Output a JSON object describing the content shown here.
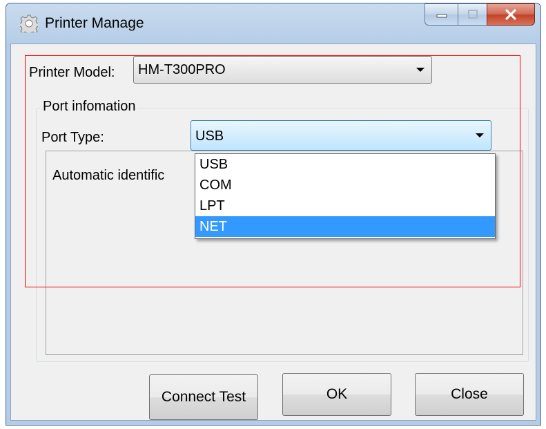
{
  "window": {
    "title": "Printer Manage",
    "icons": {
      "app": "gear-icon",
      "minimize": "minimize-icon",
      "maximize": "maximize-icon",
      "close": "close-icon"
    },
    "colors": {
      "close_button": "#c3422a",
      "highlight_red": "#ff0000",
      "selection_blue": "#3399ff"
    }
  },
  "printer_model": {
    "label": "Printer Model:",
    "value": "HM-T300PRO"
  },
  "port_info": {
    "group_label": "Port infomation",
    "port_type_label": "Port Type:",
    "port_type_value": "USB",
    "options": [
      "USB",
      "COM",
      "LPT",
      "NET"
    ],
    "highlighted_option": "NET",
    "auto_text": "Automatic identific"
  },
  "buttons": {
    "connect_test": "Connect Test",
    "ok": "OK",
    "close": "Close"
  }
}
